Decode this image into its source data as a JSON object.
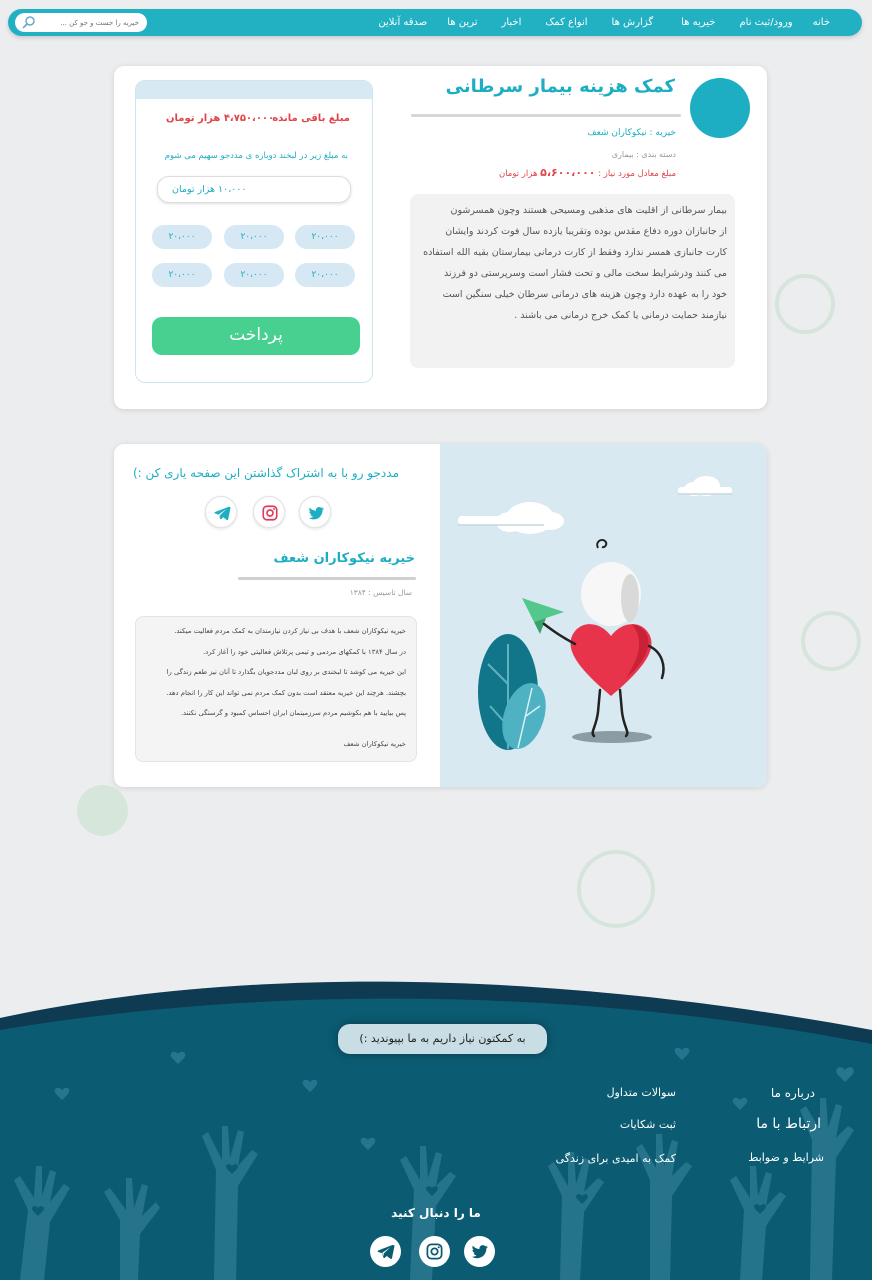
{
  "nav": {
    "items": [
      "خانه",
      "ورود/ثبت نام",
      "خیریه ها",
      "گزارش ها",
      "انواع کمک",
      "اخبار",
      "ترین ها",
      "صدقه آنلاین"
    ],
    "search_placeholder": "خیریه را جست و جو کن ..."
  },
  "campaign": {
    "title": "کمک هزینه بیمار سرطانی",
    "charity": "خیریه : نیکوکاران شعف",
    "category": "دسته بندی : بیماری",
    "amount_label": "مبلغ معادل مورد نیاز :",
    "amount_value": "۵،۶۰۰،۰۰۰",
    "amount_unit": "هزار تومان",
    "description": [
      "بیمار سرطانی از اقلیت های مذهبی ومسیحی هستند وچون همسرشون",
      "از جانبازان دوره دفاع مقدس بوده وتقریبا یازده سال فوت کردند وایشان",
      "کارت جانبازی همسر ندارد وفقط از کارت درمانی بیمارستان بقیه الله استفاده",
      "می کنند ودرشرایط سخت مالی و تحت فشار است وسرپرستی دو فرزند",
      "خود را به عهده دارد وچون هزینه های درمانی سرطان خیلی سنگین است",
      "نیازمند حمایت درمانی یا کمک خرج درمانی می باشند ."
    ]
  },
  "donate": {
    "remaining_label": "مبلغ باقی مانده",
    "remaining_value": "۴،۷۵۰،۰۰۰ هزار تومان",
    "prompt": "به مبلغ زیر در لبخند دوباره ی مددجو  سهیم می شوم",
    "input_value": "۱۰،۰۰۰  هزار تومان",
    "chips": [
      "۲۰،۰۰۰",
      "۲۰،۰۰۰",
      "۲۰،۰۰۰",
      "۲۰،۰۰۰",
      "۲۰،۰۰۰",
      "۲۰،۰۰۰"
    ],
    "pay_label": "پرداخت"
  },
  "share": {
    "title": "مددجو رو با به اشتراک گذاشتن این صفحه یاری کن :)",
    "org_name": "خیریه نیکوکاران شعف",
    "founded": "سال تاسیس : ۱۳۸۴",
    "about": [
      "خیریه نیکوکاران شعف با هدف بی نیاز کردن نیازمندان به کمک مردم فعالیت میکند.",
      "در سال ۱۳۸۴ با کمکهای مردمی و تیمی پرتلاش فعالیتی خود را آغاز کرد.",
      "این خیریه می کوشد تا لبخندی بر روی لبان مددجویان بگذارد تا آنان نیز طعم زندگی را",
      "بچشند. هرچند این خیریه معتقد است بدون کمک مردم نمی تواند این کار را انجام دهد.",
      "پس بیایید با هم بکوشیم مردم سرزمینمان ایران احساس کمبود و گرسنگی نکنند."
    ],
    "signature": "خیریه نیکوکاران شعف"
  },
  "footer": {
    "join": "به کمکتون نیاز داریم به ما بپیوندید :)",
    "links": {
      "about": "درباره ما",
      "contact": "ارتباط با ما",
      "terms": "شرایط و ضوابط",
      "faq": "سوالات متداول",
      "complaints": "ثبت شکایات",
      "hope": "کمک به امیدی برای زندگی"
    },
    "follow": "ما را دنبال کنید"
  },
  "colors": {
    "accent": "#1eaec4",
    "danger": "#e0454a",
    "pay": "#47d08f",
    "footer": "#0b5c73"
  },
  "icons": [
    "search-icon",
    "telegram-icon",
    "instagram-icon",
    "twitter-icon"
  ]
}
